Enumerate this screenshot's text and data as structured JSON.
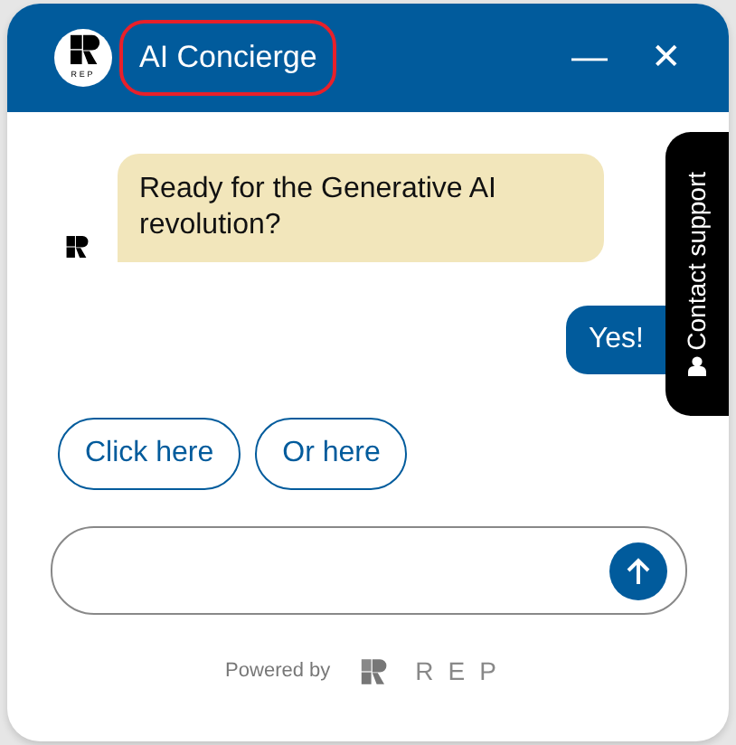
{
  "header": {
    "logo_text": "REP",
    "title": "AI Concierge",
    "title_highlighted": true,
    "minimize": "—",
    "close": "✕"
  },
  "messages": [
    {
      "kind": "bot",
      "text": "Ready for the Generative AI revolution?"
    },
    {
      "kind": "user",
      "text": "Yes!"
    }
  ],
  "quick_replies": [
    "Click here",
    "Or here"
  ],
  "contact_tab": {
    "label": "Contact support"
  },
  "footer": {
    "powered_by": "Powered by",
    "brand": "REP"
  }
}
